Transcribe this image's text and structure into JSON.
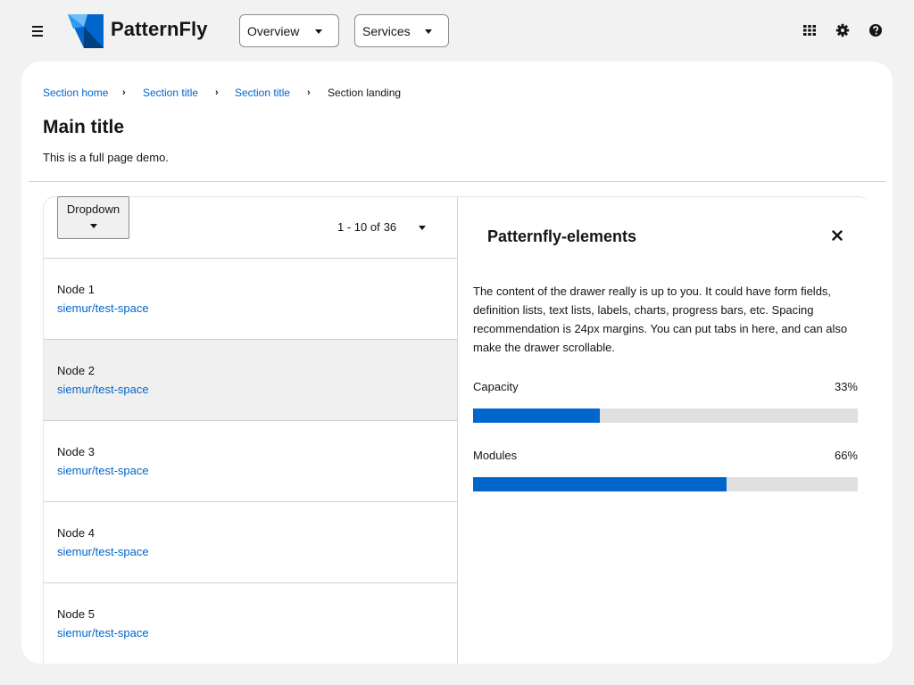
{
  "header": {
    "brand": "PatternFly",
    "nav_selects": [
      {
        "label": "Overview"
      },
      {
        "label": "Services"
      }
    ],
    "icons": [
      "hamburger-menu-icon",
      "apps-grid-icon",
      "gear-icon",
      "help-icon"
    ]
  },
  "breadcrumb": {
    "items": [
      "Section home",
      "Section title",
      "Section title",
      "Section landing"
    ]
  },
  "page": {
    "title": "Main title",
    "description": "This is a full page demo."
  },
  "toolbar": {
    "dropdown_label": "Dropdown",
    "pagination": {
      "range": "1 - 10 of",
      "total": "36"
    }
  },
  "nodes": [
    {
      "name": "Node 1",
      "link": "siemur/test-space",
      "selected": false
    },
    {
      "name": "Node 2",
      "link": "siemur/test-space",
      "selected": true
    },
    {
      "name": "Node 3",
      "link": "siemur/test-space",
      "selected": false
    },
    {
      "name": "Node 4",
      "link": "siemur/test-space",
      "selected": false
    },
    {
      "name": "Node 5",
      "link": "siemur/test-space",
      "selected": false
    }
  ],
  "drawer": {
    "title": "Patternfly-elements",
    "body": "The content of the drawer really is up to you. It could have form fields, definition lists, text lists, labels, charts, progress bars, etc. Spacing recommendation is 24px margins. You can put tabs in here, and can also make the drawer scrollable.",
    "progress": [
      {
        "label": "Capacity",
        "value_text": "33%",
        "value": 0.33
      },
      {
        "label": "Modules",
        "value_text": "66%",
        "value": 0.66
      }
    ]
  },
  "colors": {
    "link": "#0066cc",
    "progress_fill": "#0066cc",
    "progress_track": "#e0e0e0",
    "selected_row": "#f0f0f0",
    "background": "#f2f2f2"
  }
}
